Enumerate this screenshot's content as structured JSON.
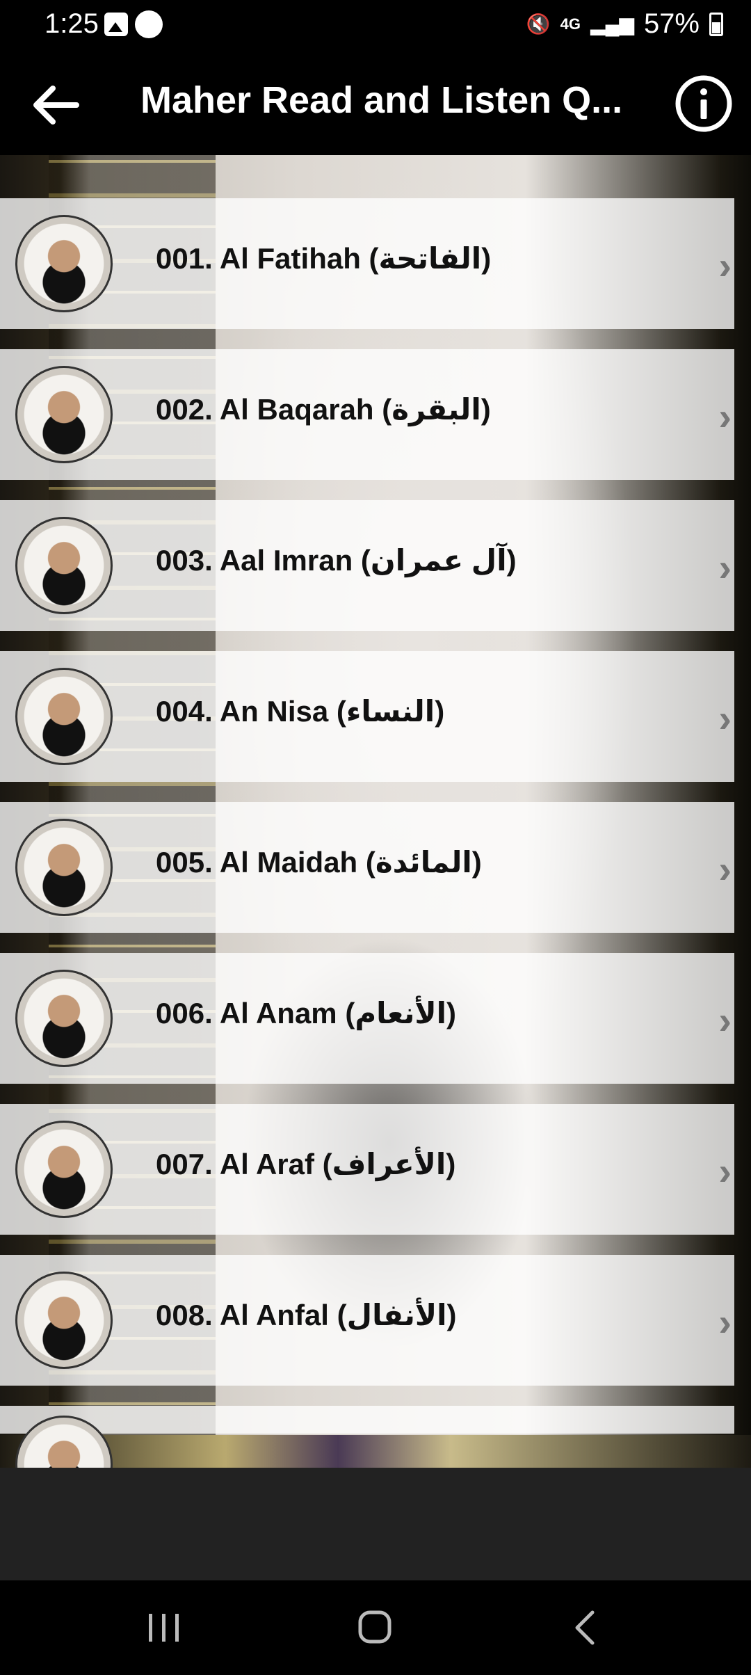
{
  "status_bar": {
    "time": "1:25",
    "network": "4G",
    "battery": "57%"
  },
  "app_bar": {
    "title": "Maher Read and Listen Q..."
  },
  "surahs": [
    {
      "label": "001. Al Fatihah (الفاتحة)"
    },
    {
      "label": "002. Al Baqarah (البقرة)"
    },
    {
      "label": "003. Aal Imran (آل عمران)"
    },
    {
      "label": "004. An Nisa (النساء)"
    },
    {
      "label": "005. Al Maidah (المائدة)"
    },
    {
      "label": "006. Al Anam (الأنعام)"
    },
    {
      "label": "007. Al Araf (الأعراف)"
    },
    {
      "label": "008. Al Anfal (الأنفال)"
    }
  ],
  "icons": {
    "back": "arrow-left-icon",
    "info": "info-icon",
    "row_chevron": "chevron-right-icon",
    "nav_recents": "recents-icon",
    "nav_home": "home-icon",
    "nav_back": "back-icon"
  }
}
